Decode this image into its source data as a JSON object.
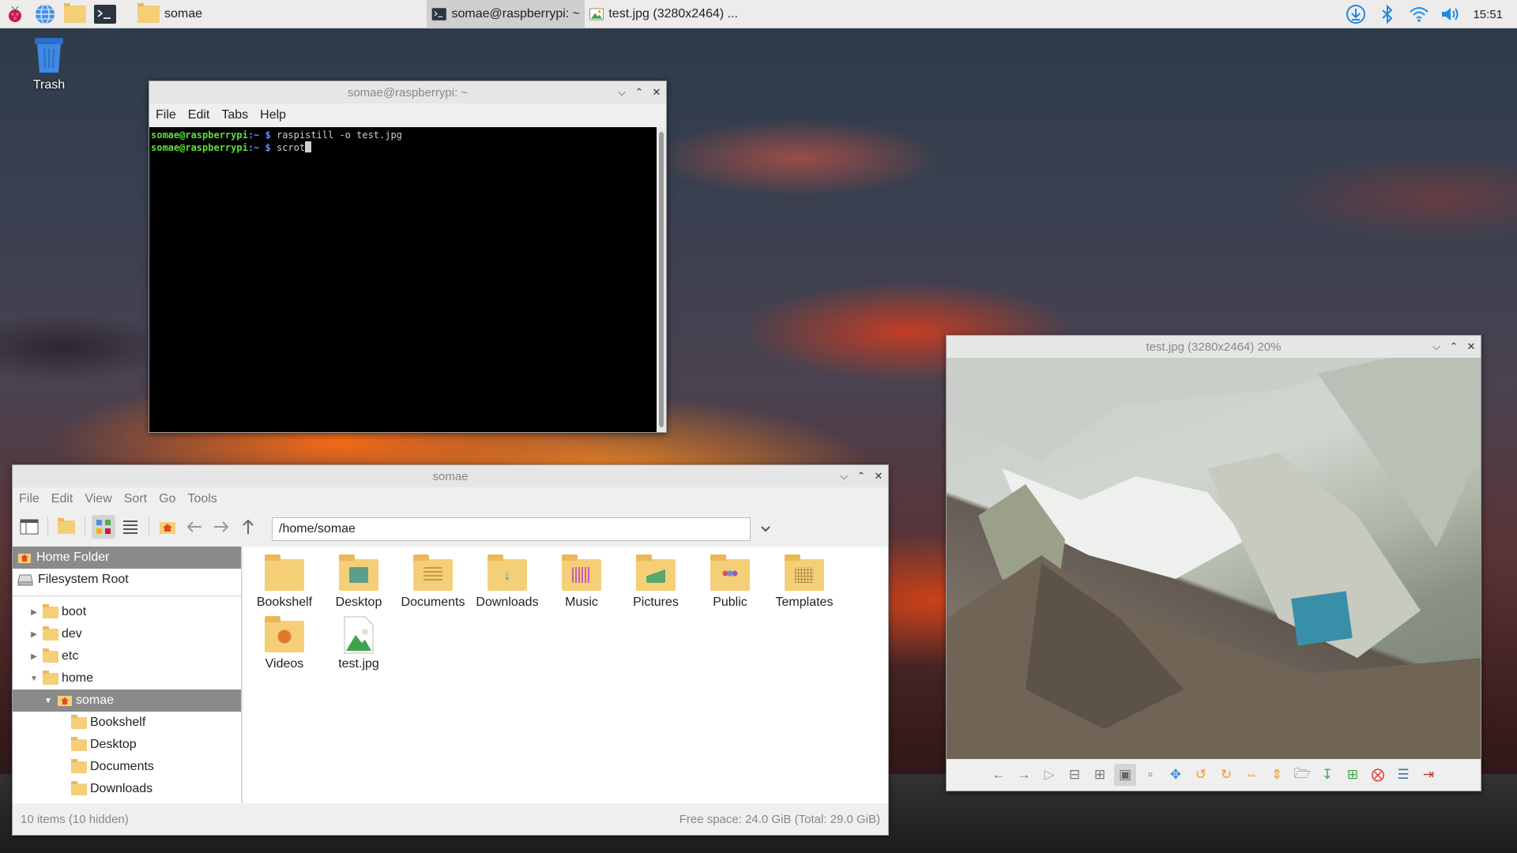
{
  "panel": {
    "tasks": [
      {
        "label": "somae"
      },
      {
        "label": "somae@raspberrypi: ~"
      },
      {
        "label": "test.jpg (3280x2464) ..."
      }
    ],
    "clock": "15:51"
  },
  "desktop": {
    "trash_label": "Trash"
  },
  "terminal": {
    "title": "somae@raspberrypi: ~",
    "menu": [
      "File",
      "Edit",
      "Tabs",
      "Help"
    ],
    "lines": [
      {
        "user": "somae@raspberrypi",
        "path": ":~",
        "prompt": " $ ",
        "cmd": "raspistill -o test.jpg"
      },
      {
        "user": "somae@raspberrypi",
        "path": ":~",
        "prompt": " $ ",
        "cmd": "scrot"
      }
    ]
  },
  "filemanager": {
    "title": "somae",
    "menu": [
      "File",
      "Edit",
      "View",
      "Sort",
      "Go",
      "Tools"
    ],
    "path": "/home/somae",
    "places": [
      {
        "label": "Home Folder"
      },
      {
        "label": "Filesystem Root"
      }
    ],
    "tree": [
      {
        "label": "boot"
      },
      {
        "label": "dev"
      },
      {
        "label": "etc"
      },
      {
        "label": "home"
      },
      {
        "label": "somae"
      },
      {
        "label": "Bookshelf"
      },
      {
        "label": "Desktop"
      },
      {
        "label": "Documents"
      },
      {
        "label": "Downloads"
      }
    ],
    "items": [
      {
        "label": "Bookshelf"
      },
      {
        "label": "Desktop"
      },
      {
        "label": "Documents"
      },
      {
        "label": "Downloads"
      },
      {
        "label": "Music"
      },
      {
        "label": "Pictures"
      },
      {
        "label": "Public"
      },
      {
        "label": "Templates"
      },
      {
        "label": "Videos"
      },
      {
        "label": "test.jpg"
      }
    ],
    "status_left": "10 items (10 hidden)",
    "status_right": "Free space: 24.0 GiB (Total: 29.0 GiB)"
  },
  "imageviewer": {
    "title": "test.jpg (3280x2464) 20%"
  },
  "colors": {
    "terminal_user": "#5ce03c",
    "terminal_path": "#6b8cff",
    "selection": "#8a8a8a",
    "folder": "#f5cf78"
  }
}
